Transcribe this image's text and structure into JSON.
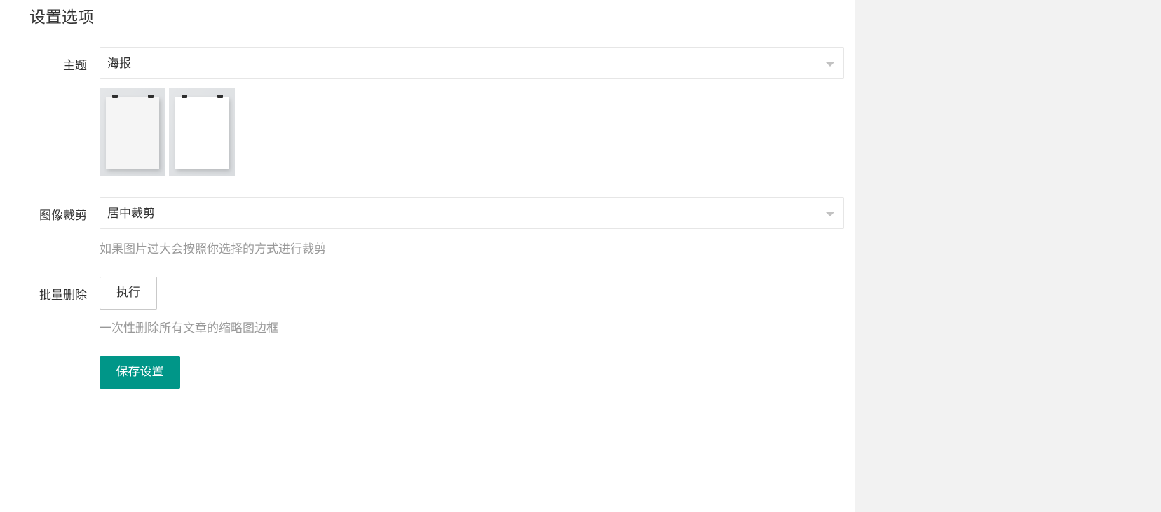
{
  "section": {
    "title": "设置选项"
  },
  "theme": {
    "label": "主题",
    "selected": "海报",
    "thumbnails": [
      {
        "name": "poster-theme-gray",
        "paper_color": "#f5f5f5"
      },
      {
        "name": "poster-theme-white",
        "paper_color": "#ffffff"
      }
    ]
  },
  "crop": {
    "label": "图像裁剪",
    "selected": "居中裁剪",
    "hint": "如果图片过大会按照你选择的方式进行裁剪"
  },
  "batch_delete": {
    "label": "批量删除",
    "button": "执行",
    "hint": "一次性删除所有文章的缩略图边框"
  },
  "actions": {
    "save": "保存设置"
  },
  "colors": {
    "primary": "#009688",
    "border": "#e6e6e6",
    "hint_text": "#999999",
    "side_panel": "#f2f2f2"
  },
  "icons": {
    "select_caret": "caret-down-icon"
  }
}
